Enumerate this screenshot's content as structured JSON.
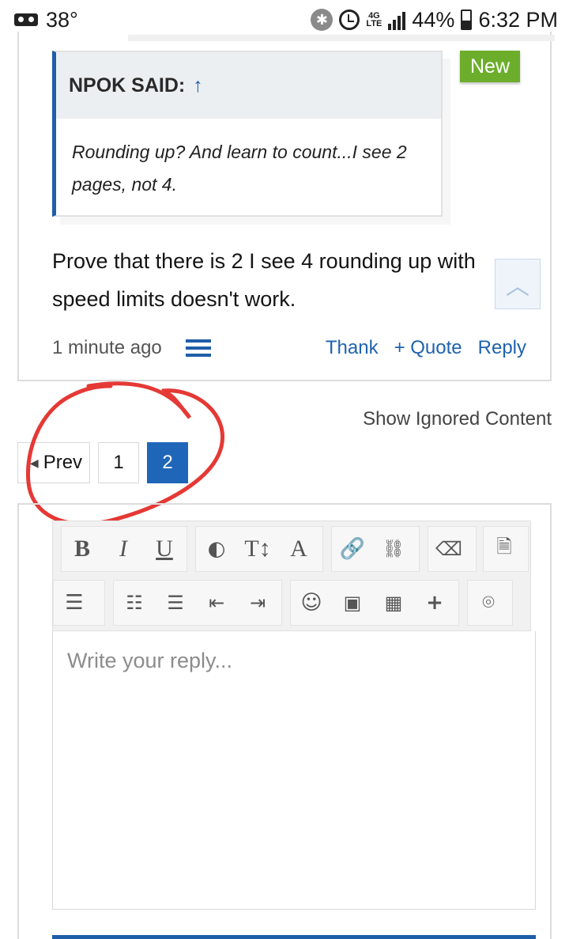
{
  "status_bar": {
    "temperature": "38°",
    "network": "4G",
    "network_sub": "LTE",
    "battery_pct": "44%",
    "time": "6:32 PM"
  },
  "post": {
    "badge": "New",
    "quote_author": "NPOK SAID:",
    "quote_arrow": "↑",
    "quote_text": "Rounding up? And learn to count...I see 2 pages, not 4.",
    "body": "Prove that there is 2 I see 4 rounding up with speed limits doesn't work.",
    "time": "1 minute ago",
    "actions": {
      "thank": "Thank",
      "quote": "+ Quote",
      "reply": "Reply"
    }
  },
  "show_ignored": "Show Ignored Content",
  "pagination": {
    "prev": "Prev",
    "pages": [
      "1",
      "2"
    ],
    "current": "2"
  },
  "editor": {
    "placeholder": "Write your reply...",
    "toolbar_labels": {
      "bold": "B",
      "italic": "I",
      "underline": "U",
      "size": "T↕",
      "font": "A"
    }
  },
  "colors": {
    "link": "#1f63ad",
    "accent": "#1f5ea8",
    "new_badge": "#6cae2c",
    "annotation": "#e53935"
  }
}
